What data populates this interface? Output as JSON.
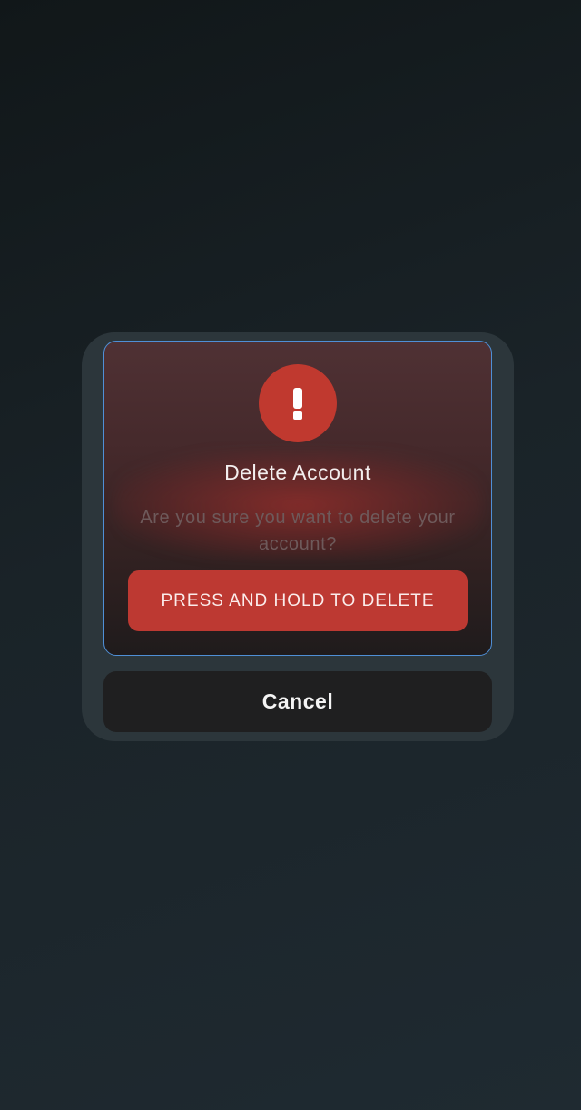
{
  "dialog": {
    "icon": "exclamation-icon",
    "title": "Delete Account",
    "message": "Are you sure you want to delete your account?",
    "delete_label": "PRESS AND HOLD TO DELETE",
    "cancel_label": "Cancel"
  },
  "colors": {
    "background": "#161e22",
    "sheet": "#2c363b",
    "danger": "#c0392f",
    "focus_border": "#4f8fd6",
    "cancel_button": "#1f1f20"
  }
}
